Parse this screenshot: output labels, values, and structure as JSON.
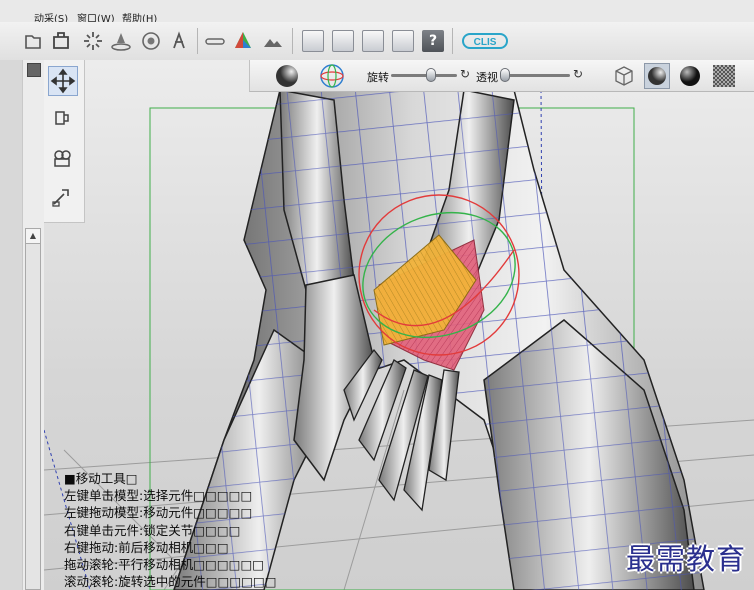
{
  "menu": {
    "items": [
      "动采(S)",
      "窗口(W)",
      "帮助(H)"
    ]
  },
  "viewport_toolbar": {
    "rotate_label": "旋转",
    "rotate_value": 0.62,
    "perspective_label": "透视",
    "perspective_value": 0.0,
    "reset_glyph": "↻"
  },
  "scroll": {
    "up_glyph": "▲"
  },
  "help_panel": {
    "title": "■移动工具□",
    "lines": [
      "左键单击模型:选择元件□□□□□",
      "左键拖动模型:移动元件□□□□□",
      "右键单击元件:锁定关节□□□□",
      "右键拖动:前后移动相机□□□",
      "拖动滚轮:平行移动相机□□□□□□",
      "滚动滚轮:旋转选中的元件□□□□□□"
    ]
  },
  "watermark": {
    "text": "最需教育"
  },
  "toolbar": {
    "help_label": "?",
    "logo_label": "CLIS"
  },
  "colors": {
    "accent": "#2f7fd0",
    "mesh_grid": "#4b55b8",
    "gizmo_ring": "#e23b3b",
    "gizmo_green": "#34b34a",
    "highlight_fill": "#f2b33a",
    "select_fill": "#e2607a"
  }
}
